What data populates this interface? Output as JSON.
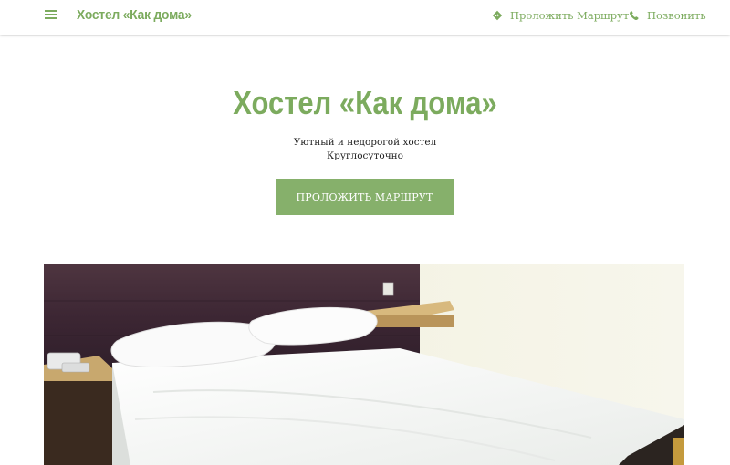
{
  "header": {
    "menu_icon": "menu-icon",
    "brand": "Хостел «Как дома»",
    "route_link": {
      "icon": "directions-icon",
      "label": "Проложить Маршрут"
    },
    "call_link": {
      "icon": "phone-icon",
      "label": "Позвонить"
    }
  },
  "hero": {
    "title": "Хостел «Как дома»",
    "subtitle_line1": "Уютный и недорогой хостел",
    "subtitle_line2": "Круглосуточно",
    "cta_label": "ПРОЛОЖИТЬ МАРШРУТ"
  },
  "photo": {
    "subject": "hotel-room-bed"
  },
  "colors": {
    "accent": "#7cab5e",
    "button": "#86b06b",
    "text": "#222222"
  }
}
